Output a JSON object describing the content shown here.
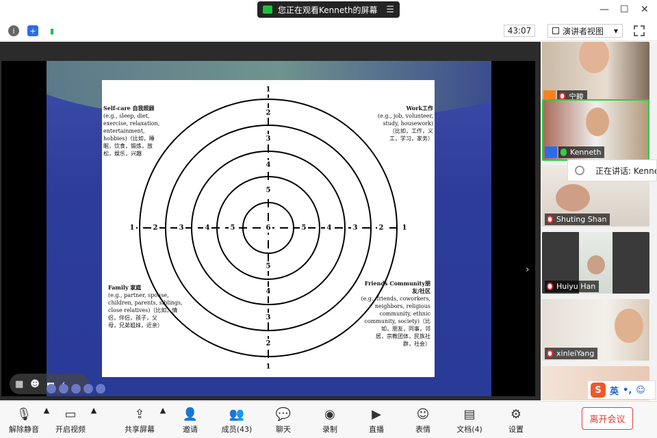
{
  "title_bar": {
    "share_notice": "您正在观看Kenneth的屏幕",
    "minimize": "—",
    "maximize": "☐",
    "close": "✕"
  },
  "meeting_bar": {
    "info_icon": "i",
    "security_icon": "+",
    "signal_icon": "▮",
    "timer": "43:07",
    "view_mode": "演讲者视图",
    "view_caret": "▼"
  },
  "slide": {
    "ring_labels": [
      "1",
      "2",
      "3",
      "4",
      "5",
      "6"
    ],
    "quadrants": {
      "top_left": {
        "title": "Self-care 自我照顾",
        "body": [
          "(e.g., sleep, diet,",
          "exercise, relaxation,",
          "entertainment,",
          "hobbies)（比如，睡",
          "眠，饮食，锻炼，放",
          "松，娱乐，兴趣"
        ]
      },
      "top_right": {
        "title": "Work工作",
        "body": [
          "(e.g., job, volunteer,",
          "study, housework)",
          "（比如，工作，义",
          "工，学习，家务）"
        ]
      },
      "bottom_left": {
        "title": "Family 家庭",
        "body": [
          "(e.g., partner, spouse,",
          "children, parents, siblings,",
          "close relatives)（比如，情",
          "侣，伴侣，孩子，父",
          "母，兄弟姐妹，近亲）"
        ]
      },
      "bottom_right": {
        "title": "Friends   Community朋",
        "title2": "友/社区",
        "body": [
          "(e.g., friends, coworkers,",
          "neighbors, religious",
          "community, ethnic",
          "community, society)（比",
          "如，朋友，同事，邻",
          "居，宗教团体，民族社",
          "群，社会）"
        ]
      }
    }
  },
  "floating_controls": {
    "grid": "▦",
    "emoji": "☻",
    "chat": "▬",
    "collapse": "‹"
  },
  "gallery": {
    "collapse_arrow": "›",
    "participants": [
      {
        "name": "宁畯",
        "muted": true,
        "host": true
      },
      {
        "name": "Kenneth",
        "muted": false,
        "cohost": true
      },
      {
        "name": "Shuting Shan",
        "muted": true
      },
      {
        "name": "Huiyu Han",
        "muted": true
      },
      {
        "name": "xinleiYang",
        "muted": true
      },
      {
        "name": "",
        "muted": true
      }
    ],
    "speaking_tip": "正在讲话: Kenne"
  },
  "ime": {
    "logo": "S",
    "lang": "英",
    "punct": "•,",
    "emoji": "☺"
  },
  "toolbar": {
    "mute": "解除静音",
    "video": "开启视频",
    "share": "共享屏幕",
    "invite": "邀请",
    "participants": "成员(43)",
    "chat": "聊天",
    "record": "录制",
    "live": "直播",
    "reactions": "表情",
    "docs": "文档(4)",
    "settings": "设置",
    "leave": "离开会议",
    "caret": "▲"
  },
  "colors": {
    "slide_blue": "#2d3c9a",
    "accent_green": "#1fbf3f",
    "leave_red": "#e03a3a",
    "host_orange": "#f58220",
    "cohost_blue": "#2b6de8"
  }
}
